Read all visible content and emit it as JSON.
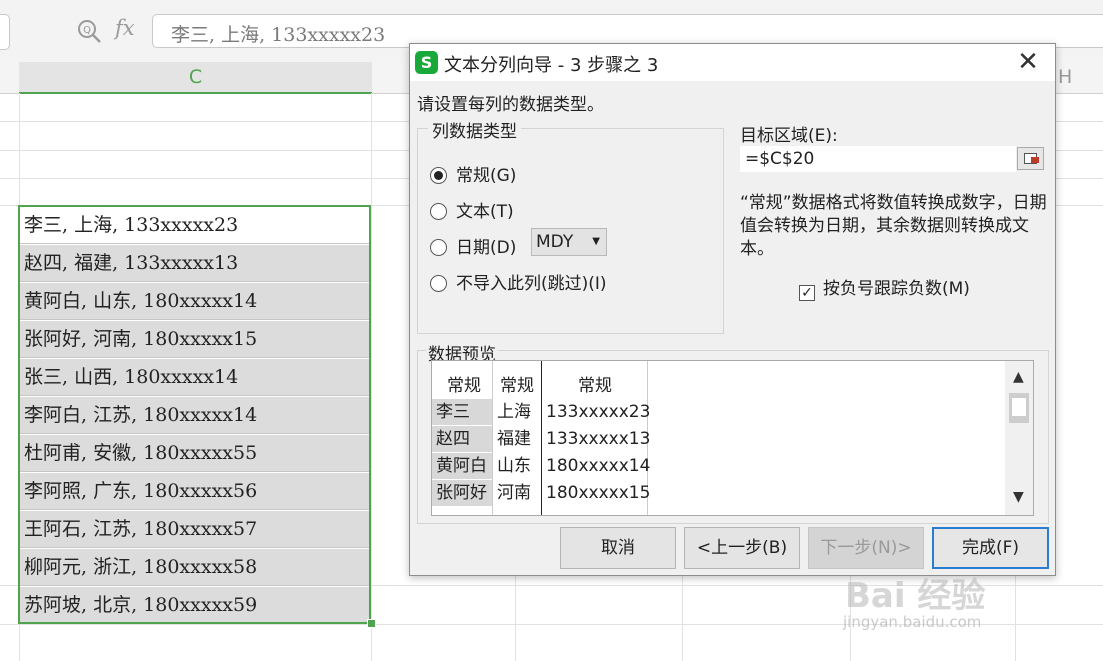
{
  "formula_bar": {
    "fx_label": "fx",
    "value": "李三, 上海, 133xxxxx23"
  },
  "sheet": {
    "columns": {
      "c": "C",
      "h": "H"
    },
    "cells": [
      "李三, 上海, 133xxxxx23",
      "赵四, 福建, 133xxxxx13",
      "黄阿白, 山东, 180xxxxx14",
      "张阿好, 河南, 180xxxxx15",
      "张三, 山西, 180xxxxx14",
      "李阿白, 江苏, 180xxxxx14",
      "杜阿甫, 安徽, 180xxxxx55",
      "李阿照, 广东, 180xxxxx56",
      "王阿石, 江苏, 180xxxxx57",
      "柳阿元, 浙江, 180xxxxx58",
      "苏阿坡, 北京, 180xxxxx59"
    ]
  },
  "dialog": {
    "app_icon": "S",
    "title": "文本分列向导 - 3 步骤之 3",
    "close": "✕",
    "prompt": "请设置每列的数据类型。",
    "column_type": {
      "group_title": "列数据类型",
      "options": [
        "常规(G)",
        "文本(T)",
        "日期(D)",
        "不导入此列(跳过)(I)"
      ],
      "selected": "常规(G)",
      "date_format": "MDY"
    },
    "target": {
      "label": "目标区域(E):",
      "value": "=$C$20"
    },
    "description": "“常规”数据格式将数值转换成数字，日期值会转换为日期，其余数据则转换成文本。",
    "negative_checkbox": {
      "label": "按负号跟踪负数(M)",
      "checked": true
    },
    "preview": {
      "title": "数据预览",
      "headers": [
        "常规",
        "常规",
        "常规"
      ],
      "rows": [
        [
          "李三",
          "上海",
          "133xxxxx23"
        ],
        [
          "赵四",
          "福建",
          "133xxxxx13"
        ],
        [
          "黄阿白",
          "山东",
          "180xxxxx14"
        ],
        [
          "张阿好",
          "河南",
          "180xxxxx15"
        ]
      ]
    },
    "buttons": {
      "cancel": "取消",
      "back": "<上一步(B)",
      "next": "下一步(N)>",
      "finish": "完成(F)"
    }
  },
  "watermark": {
    "brand": "Bai 经验",
    "url": "jingyan.baidu.com"
  }
}
